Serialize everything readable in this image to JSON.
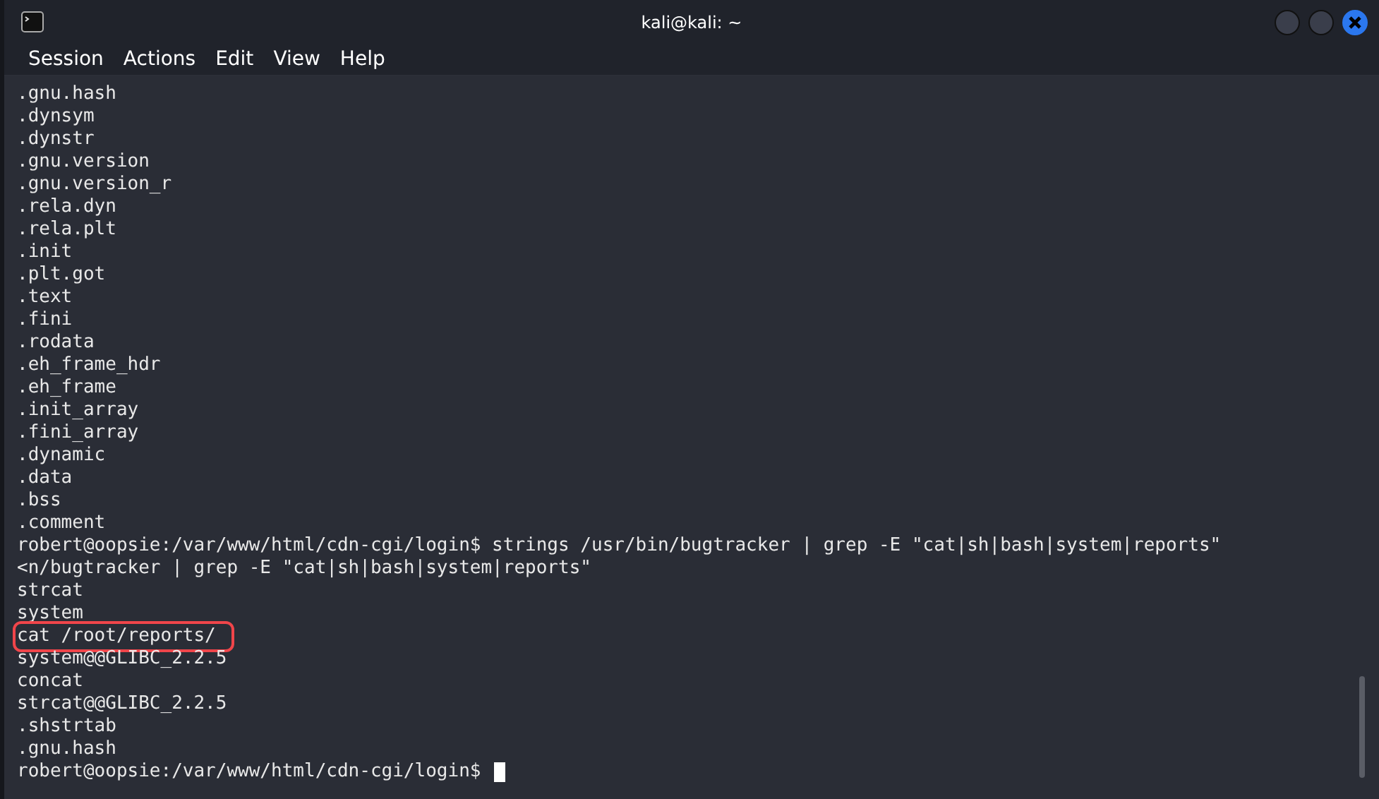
{
  "window": {
    "title": "kali@kali: ~"
  },
  "menu": [
    "Session",
    "Actions",
    "Edit",
    "View",
    "Help"
  ],
  "terminal": {
    "lines": [
      {
        "text": ".gnu.hash",
        "highlighted": false
      },
      {
        "text": ".dynsym",
        "highlighted": false
      },
      {
        "text": ".dynstr",
        "highlighted": false
      },
      {
        "text": ".gnu.version",
        "highlighted": false
      },
      {
        "text": ".gnu.version_r",
        "highlighted": false
      },
      {
        "text": ".rela.dyn",
        "highlighted": false
      },
      {
        "text": ".rela.plt",
        "highlighted": false
      },
      {
        "text": ".init",
        "highlighted": false
      },
      {
        "text": ".plt.got",
        "highlighted": false
      },
      {
        "text": ".text",
        "highlighted": false
      },
      {
        "text": ".fini",
        "highlighted": false
      },
      {
        "text": ".rodata",
        "highlighted": false
      },
      {
        "text": ".eh_frame_hdr",
        "highlighted": false
      },
      {
        "text": ".eh_frame",
        "highlighted": false
      },
      {
        "text": ".init_array",
        "highlighted": false
      },
      {
        "text": ".fini_array",
        "highlighted": false
      },
      {
        "text": ".dynamic",
        "highlighted": false
      },
      {
        "text": ".data",
        "highlighted": false
      },
      {
        "text": ".bss",
        "highlighted": false
      },
      {
        "text": ".comment",
        "highlighted": false
      },
      {
        "text": "robert@oopsie:/var/www/html/cdn-cgi/login$ strings /usr/bin/bugtracker | grep -E \"cat|sh|bash|system|reports\"",
        "highlighted": false
      },
      {
        "text": "<n/bugtracker | grep -E \"cat|sh|bash|system|reports\"",
        "highlighted": false
      },
      {
        "text": "strcat",
        "highlighted": false
      },
      {
        "text": "system",
        "highlighted": false
      },
      {
        "text": "cat /root/reports/",
        "highlighted": true
      },
      {
        "text": "system@@GLIBC_2.2.5",
        "highlighted": false
      },
      {
        "text": "concat",
        "highlighted": false
      },
      {
        "text": "strcat@@GLIBC_2.2.5",
        "highlighted": false
      },
      {
        "text": ".shstrtab",
        "highlighted": false
      },
      {
        "text": ".gnu.hash",
        "highlighted": false
      }
    ],
    "prompt": "robert@oopsie:/var/www/html/cdn-cgi/login$"
  }
}
